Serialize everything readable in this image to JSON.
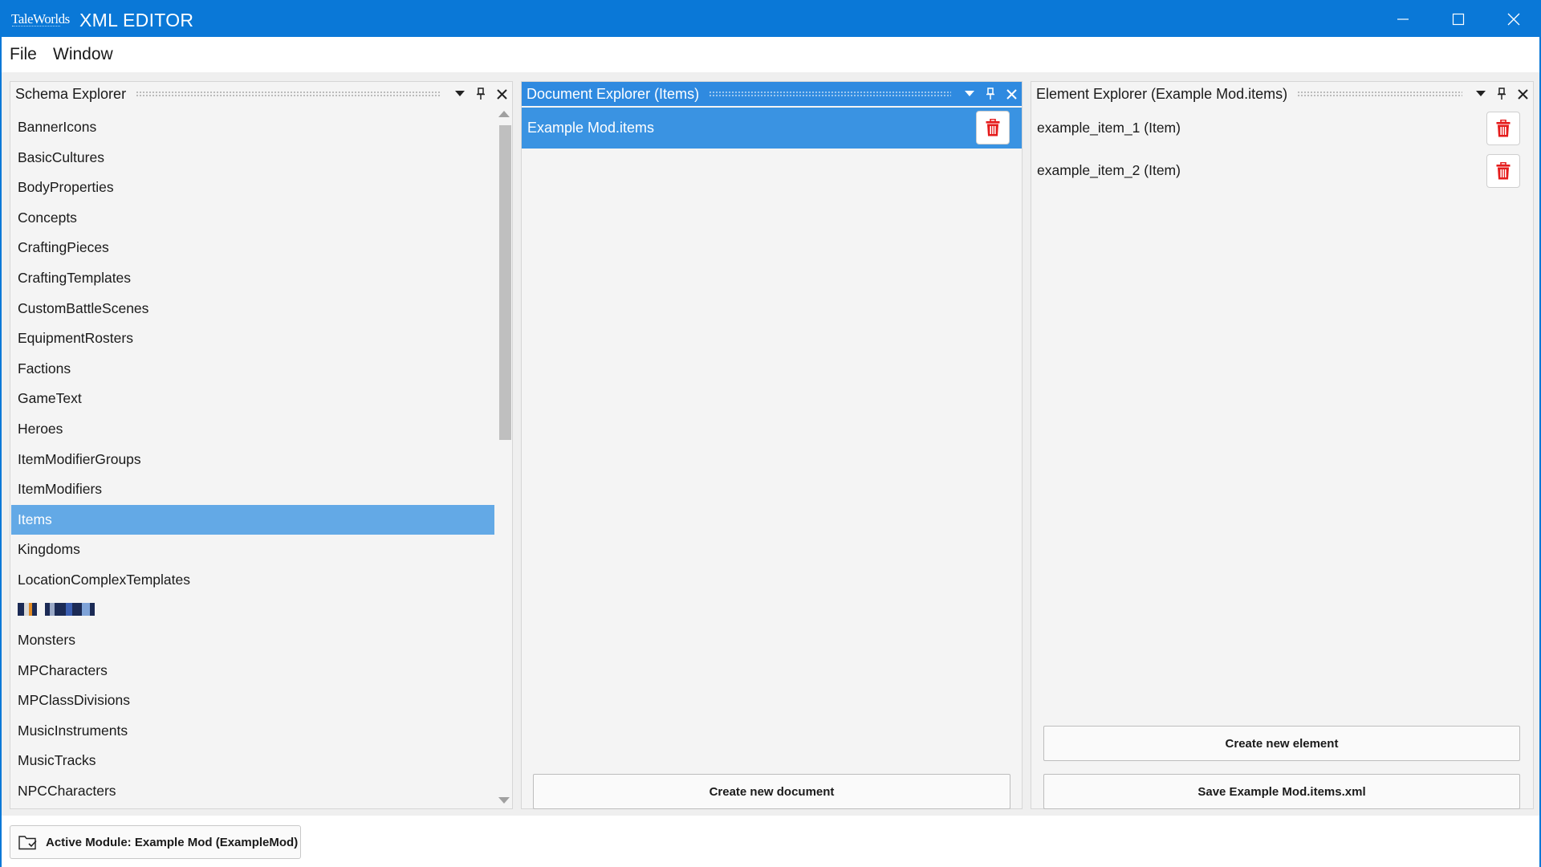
{
  "window": {
    "logo_text": "TaleWorlds",
    "title": "XML EDITOR"
  },
  "menu": [
    "File",
    "Window"
  ],
  "schema_explorer": {
    "title": "Schema Explorer",
    "items": [
      "BannerIcons",
      "BasicCultures",
      "BodyProperties",
      "Concepts",
      "CraftingPieces",
      "CraftingTemplates",
      "CustomBattleScenes",
      "EquipmentRosters",
      "Factions",
      "GameText",
      "Heroes",
      "ItemModifierGroups",
      "ItemModifiers",
      "Items",
      "Kingdoms",
      "LocationComplexTemplates",
      "",
      "Monsters",
      "MPCharacters",
      "MPClassDivisions",
      "MusicInstruments",
      "MusicTracks",
      "NPCCharacters"
    ],
    "selected": "Items"
  },
  "document_explorer": {
    "title": "Document Explorer (Items)",
    "documents": [
      "Example Mod.items"
    ],
    "create_button": "Create new document"
  },
  "element_explorer": {
    "title": "Element Explorer (Example Mod.items)",
    "elements": [
      "example_item_1 (Item)",
      "example_item_2 (Item)"
    ],
    "create_button": "Create new element",
    "save_button": "Save Example Mod.items.xml"
  },
  "status": {
    "active_module": "Active Module: Example Mod (ExampleMod)"
  },
  "colors": {
    "accent": "#0a78d7",
    "selection": "#63a9e6",
    "delete": "#e51c1c"
  }
}
